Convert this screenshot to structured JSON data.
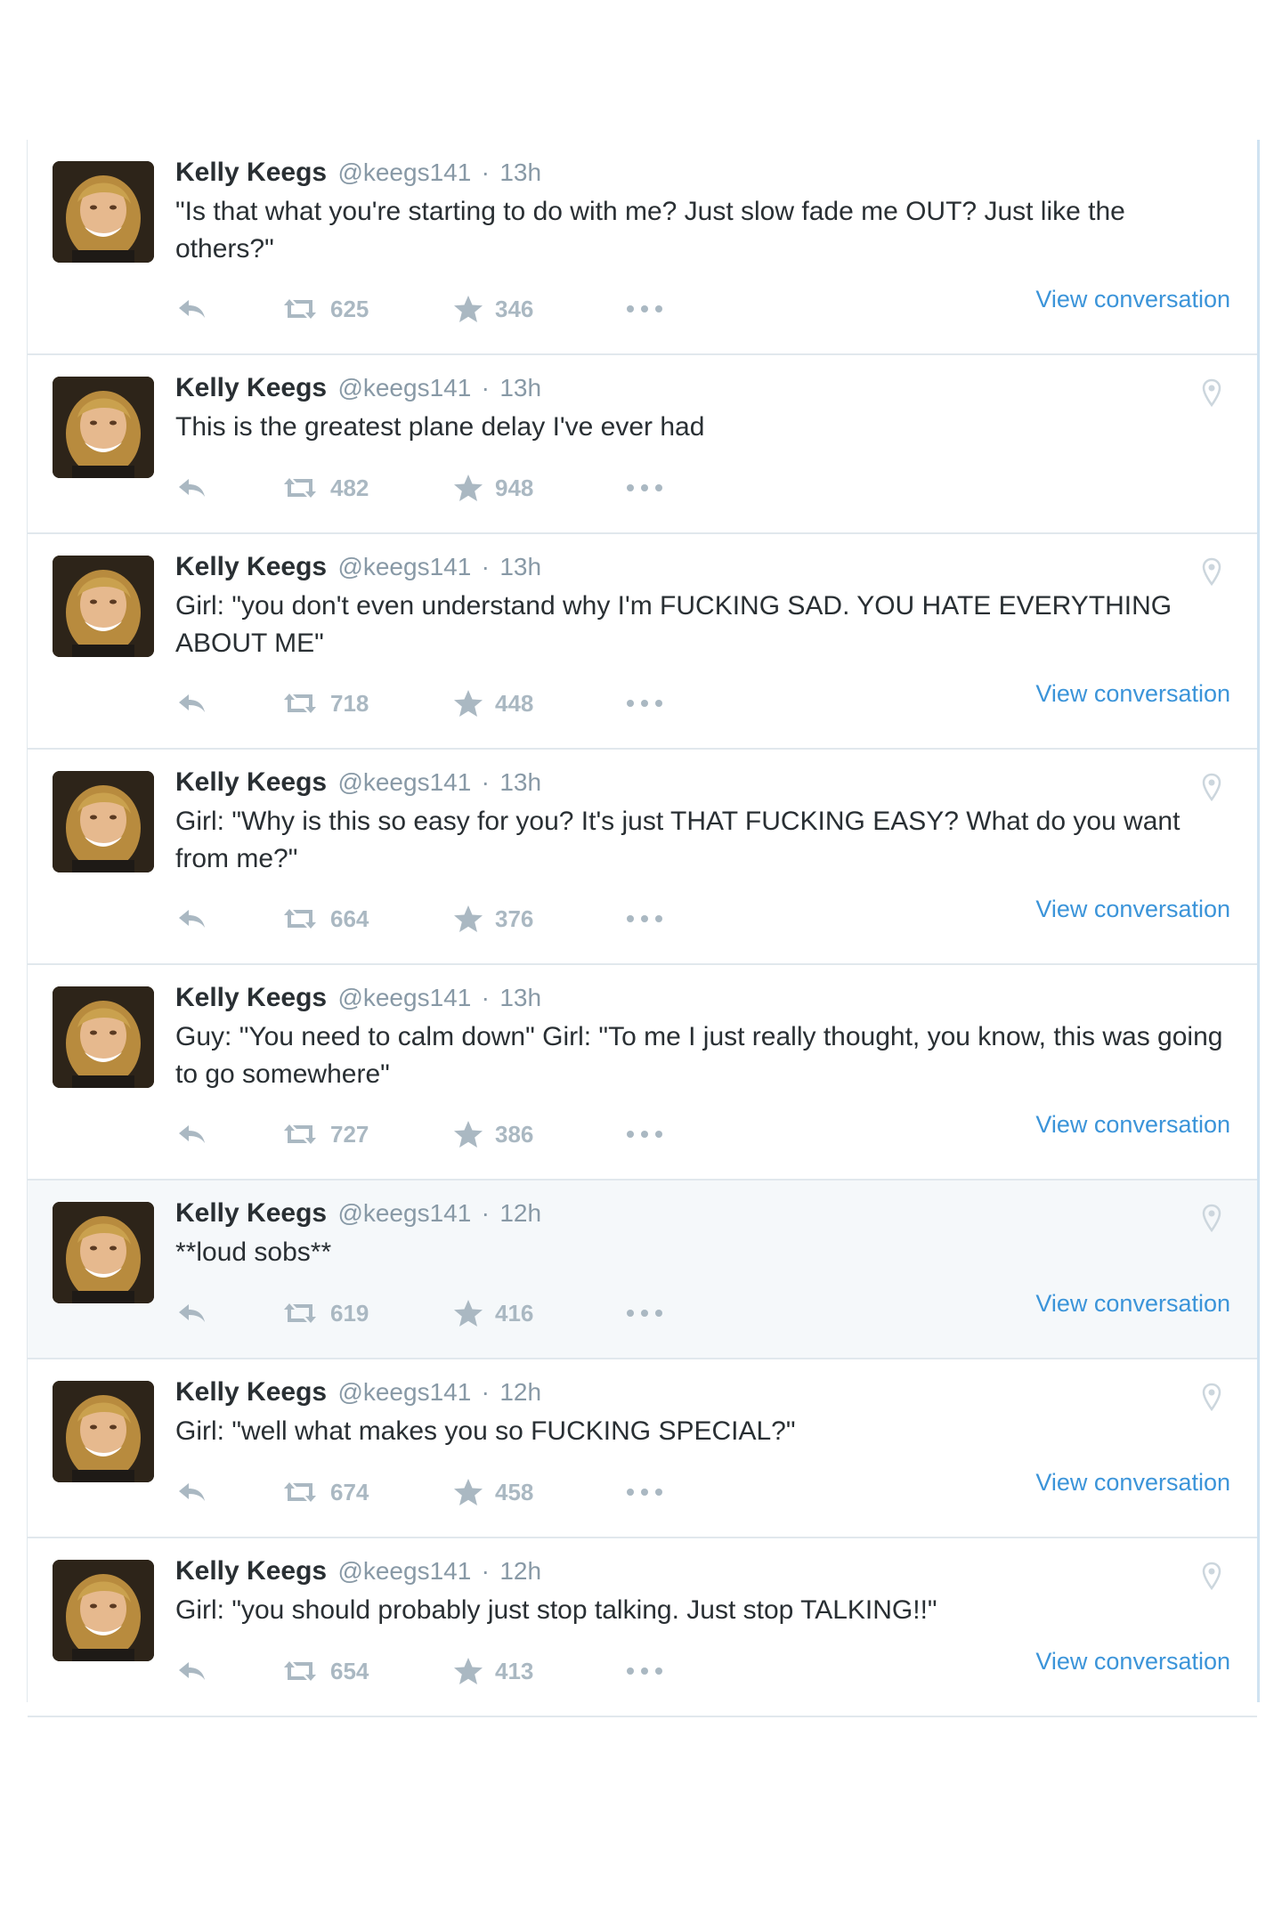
{
  "colors": {
    "link": "#3b94d9",
    "muted": "#8899a6",
    "action": "#aab8c2",
    "highlight_bg": "#f5f8fa"
  },
  "tweets": [
    {
      "name": "Kelly Keegs",
      "handle": "@keegs141",
      "sep": "·",
      "time": "13h",
      "text": "\"Is that what you're starting to do with me? Just slow fade me OUT? Just like the others?\"",
      "retweets": "625",
      "favorites": "346",
      "view_conversation": "View conversation",
      "geo_icon": false
    },
    {
      "name": "Kelly Keegs",
      "handle": "@keegs141",
      "sep": "·",
      "time": "13h",
      "text": "This is the greatest plane delay I've ever had",
      "retweets": "482",
      "favorites": "948",
      "view_conversation": "",
      "geo_icon": true
    },
    {
      "name": "Kelly Keegs",
      "handle": "@keegs141",
      "sep": "·",
      "time": "13h",
      "text": "Girl: \"you don't even understand why I'm FUCKING SAD. YOU HATE EVERYTHING ABOUT ME\"",
      "retweets": "718",
      "favorites": "448",
      "view_conversation": "View conversation",
      "geo_icon": true
    },
    {
      "name": "Kelly Keegs",
      "handle": "@keegs141",
      "sep": "·",
      "time": "13h",
      "text": "Girl: \"Why is this so easy for you? It's just THAT FUCKING EASY? What do you want from me?\"",
      "retweets": "664",
      "favorites": "376",
      "view_conversation": "View conversation",
      "geo_icon": true
    },
    {
      "name": "Kelly Keegs",
      "handle": "@keegs141",
      "sep": "·",
      "time": "13h",
      "text": "Guy: \"You need to calm down\" Girl: \"To me I just really thought, you know, this was going to go somewhere\"",
      "retweets": "727",
      "favorites": "386",
      "view_conversation": "View conversation",
      "geo_icon": false
    },
    {
      "name": "Kelly Keegs",
      "handle": "@keegs141",
      "sep": "·",
      "time": "12h",
      "text": "**loud sobs**",
      "retweets": "619",
      "favorites": "416",
      "view_conversation": "View conversation",
      "geo_icon": true
    },
    {
      "name": "Kelly Keegs",
      "handle": "@keegs141",
      "sep": "·",
      "time": "12h",
      "text": "Girl: \"well what makes you so FUCKING SPECIAL?\"",
      "retweets": "674",
      "favorites": "458",
      "view_conversation": "View conversation",
      "geo_icon": true
    },
    {
      "name": "Kelly Keegs",
      "handle": "@keegs141",
      "sep": "·",
      "time": "12h",
      "text": "Girl: \"you should probably just stop talking. Just stop TALKING!!\"",
      "retweets": "654",
      "favorites": "413",
      "view_conversation": "View conversation",
      "geo_icon": true
    }
  ]
}
